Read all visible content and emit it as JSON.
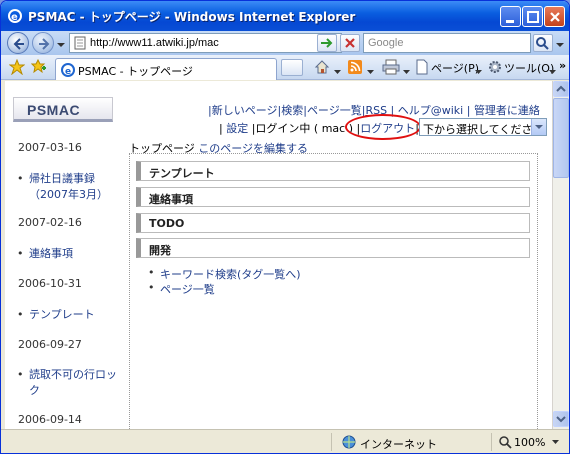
{
  "window": {
    "title": "PSMAC - トップページ - Windows Internet Explorer"
  },
  "browser": {
    "url": "http://www11.atwiki.jp/mac",
    "search_placeholder": "Google",
    "tab_title": "PSMAC - トップページ",
    "page_menu": "ページ(P)",
    "tools_menu": "ツール(O)"
  },
  "site": {
    "logo": "PSMAC",
    "nav": [
      "新しいページ",
      "検索",
      "ページ一覧",
      "RSS",
      "ヘルプ@wiki",
      "管理者に連絡"
    ],
    "settings": "設定",
    "login_status": "ログイン中 ( mac )",
    "logout": "ログアウト",
    "select_placeholder": "下から選択してください",
    "breadcrumb_current": "トップページ",
    "edit_link": "このページを編集する"
  },
  "sidebar": {
    "entries": [
      {
        "date": "2007-03-16",
        "link": "帰社日議事録（2007年3月）"
      },
      {
        "date": "2007-02-16",
        "link": "連絡事項"
      },
      {
        "date": "2006-10-31",
        "link": "テンプレート"
      },
      {
        "date": "2006-09-27",
        "link": "読取不可の行ロック"
      },
      {
        "date": "2006-09-14",
        "link": ""
      }
    ]
  },
  "main": {
    "sections": [
      "テンプレート",
      "連絡事項",
      "TODO",
      "開発"
    ],
    "dev_links": [
      "キーワード検索(タグ一覧へ)",
      "ページ一覧"
    ]
  },
  "status": {
    "zone": "インターネット",
    "zoom": "100%"
  }
}
